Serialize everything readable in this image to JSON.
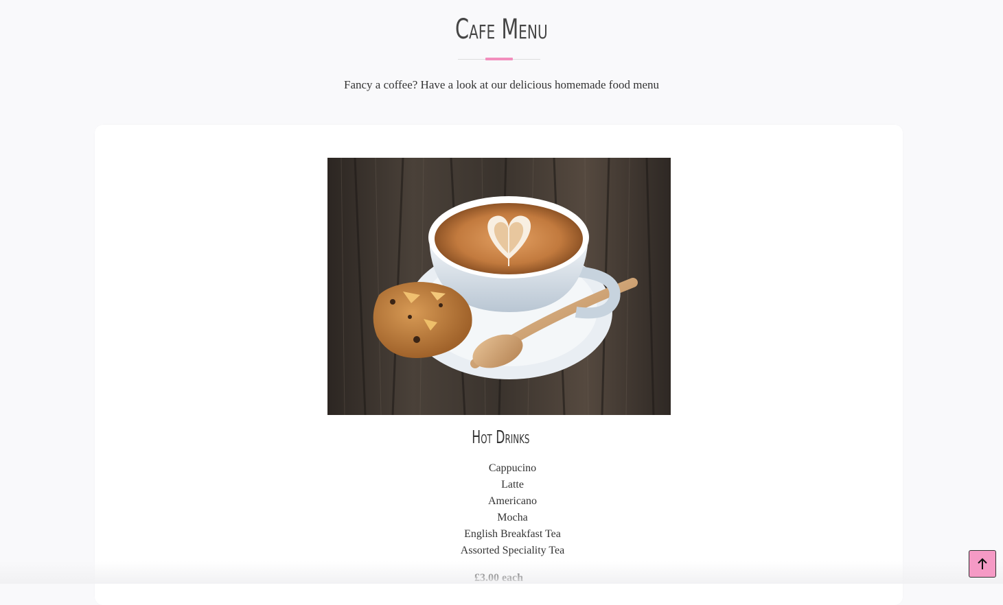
{
  "header": {
    "title": "Cafe Menu",
    "subtitle": "Fancy a coffee? Have a look at our delicious homemade food menu"
  },
  "section": {
    "image_alt": "Latte art heart in a white cup on a saucer with a wooden spoon and a cookie on a rustic wooden table",
    "title": "Hot Drinks",
    "items": [
      "Cappucino",
      "Latte",
      "Americano",
      "Mocha",
      "English Breakfast Tea",
      "Assorted Speciality Tea"
    ],
    "price": "£3.00 each"
  },
  "scroll_top": {
    "icon": "arrow-up-icon"
  },
  "colors": {
    "accent": "#f28ebd",
    "button": "#f59ac5",
    "background": "#f9f9fb",
    "card": "#ffffff",
    "text": "#333333"
  }
}
